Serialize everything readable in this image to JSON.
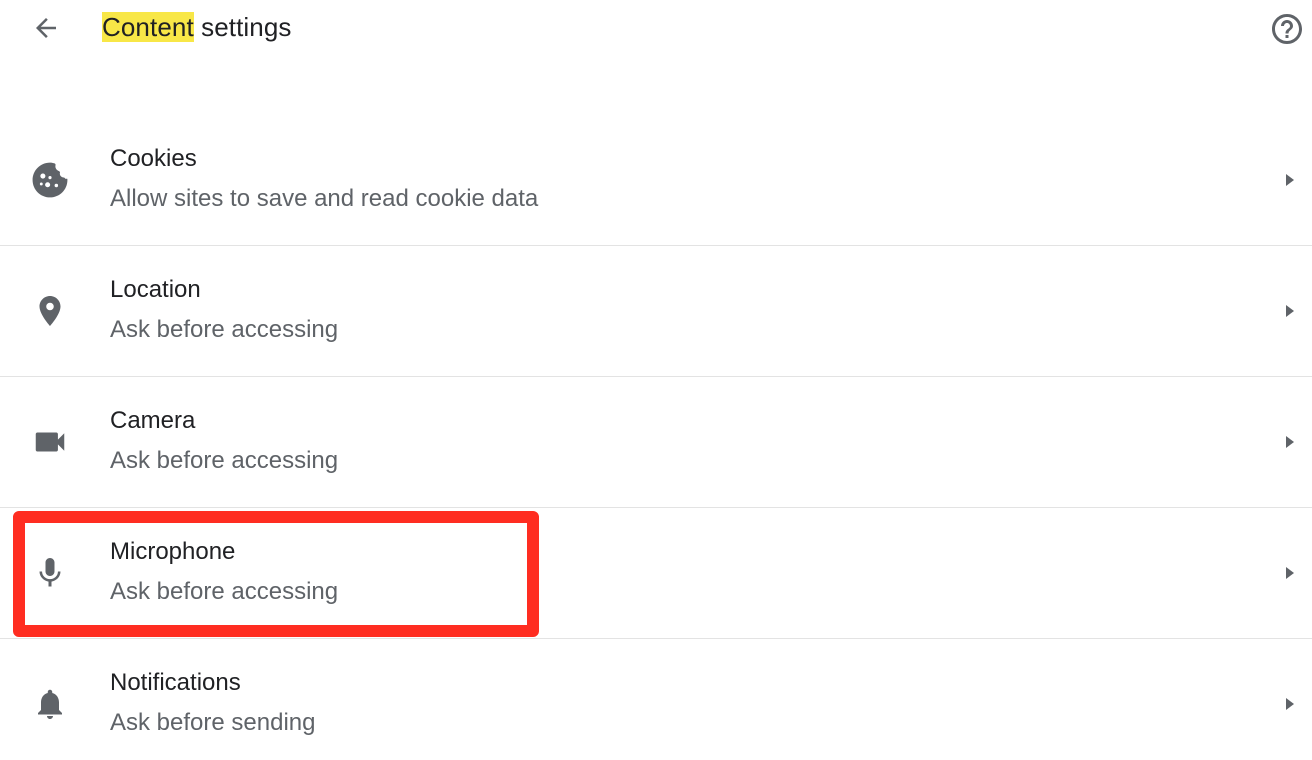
{
  "header": {
    "title_highlight": "Content",
    "title_rest": " settings",
    "back_icon": "arrow-back-icon",
    "help_icon": "help-circle-icon"
  },
  "settings": [
    {
      "label": "Cookies",
      "sub": "Allow sites to save and read cookie data",
      "icon": "cookie-icon"
    },
    {
      "label": "Location",
      "sub": "Ask before accessing",
      "icon": "location-pin-icon"
    },
    {
      "label": "Camera",
      "sub": "Ask before accessing",
      "icon": "camera-icon"
    },
    {
      "label": "Microphone",
      "sub": "Ask before accessing",
      "icon": "microphone-icon"
    },
    {
      "label": "Notifications",
      "sub": "Ask before sending",
      "icon": "bell-icon"
    }
  ],
  "colors": {
    "title_highlight": "#f8e747",
    "annotation": "#ff2d21",
    "icon": "#5f6368"
  }
}
